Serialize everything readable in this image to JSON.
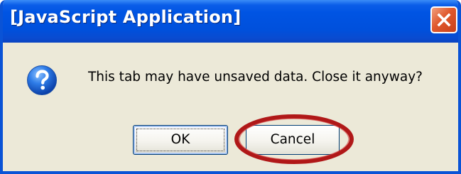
{
  "dialog": {
    "title": "[JavaScript Application]",
    "message": "This tab may have unsaved data. Close it anyway?",
    "icon": "question-icon",
    "close_icon": "close-icon"
  },
  "buttons": {
    "ok_label": "OK",
    "cancel_label": "Cancel"
  },
  "annotation": {
    "highlight": "cancel-button",
    "color": "#b01818"
  },
  "colors": {
    "titlebar": "#0054e3",
    "dialog_bg": "#ece9d8",
    "close_button": "#e0582c"
  }
}
